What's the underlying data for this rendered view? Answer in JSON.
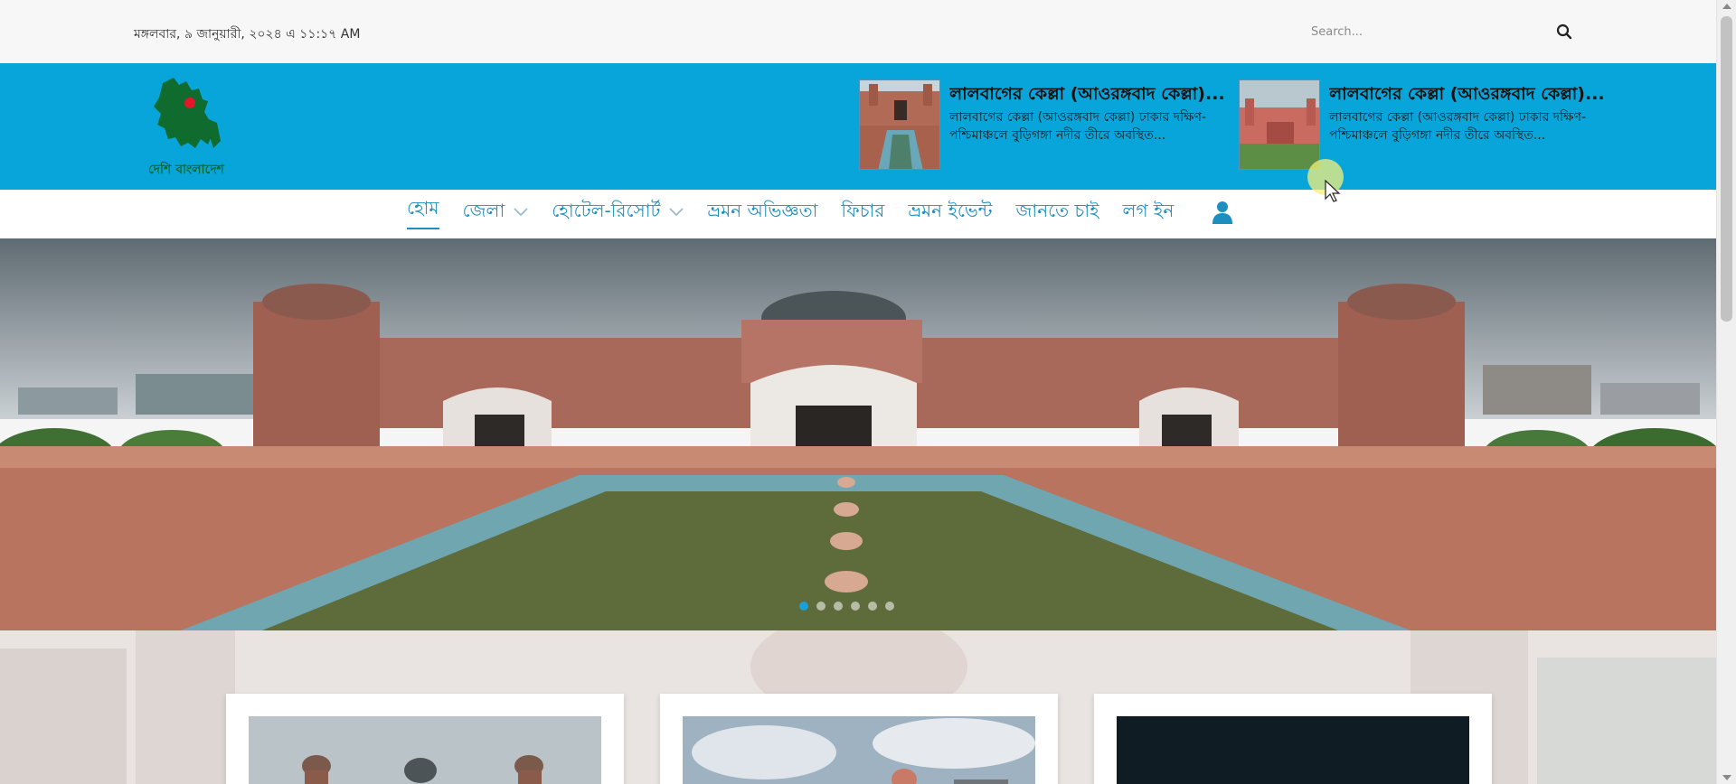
{
  "topbar": {
    "date": "মঙ্গলবার, ৯ জানুয়ারী, ২০২৪ এ ১১:১৭ AM",
    "search_placeholder": "Search...",
    "search_icon": "search-icon"
  },
  "header": {
    "logo_text": "দেশি বাংলাদেশ",
    "news": [
      {
        "title": "লালবাগের কেল্লা (আওরঙ্গবাদ কেল্লা)...",
        "excerpt": "লালবাগের কেল্লা (আওরঙ্গবাদ কেল্লা) ঢাকার দক্ষিণ-পশ্চিমাঞ্চলে বুড়িগঙ্গা নদীর তীরে অবস্থিত..."
      },
      {
        "title": "লালবাগের কেল্লা (আওরঙ্গবাদ কেল্লা)...",
        "excerpt": "লালবাগের কেল্লা (আওরঙ্গবাদ কেল্লা) ঢাকার দক্ষিণ-পশ্চিমাঞ্চলে বুড়িগঙ্গা নদীর তীরে অবস্থিত..."
      }
    ]
  },
  "nav": {
    "items": [
      {
        "label": "হোম"
      },
      {
        "label": "জেলা"
      },
      {
        "label": "হোটেল-রিসোর্ট"
      },
      {
        "label": "ভ্রমন অভিজ্ঞতা"
      },
      {
        "label": "ফিচার"
      },
      {
        "label": "ভ্রমন ইভেন্ট"
      },
      {
        "label": "জানতে চাই"
      },
      {
        "label": "লগ ইন"
      }
    ],
    "user_icon": "user-icon"
  },
  "slider": {
    "slide_count": 6,
    "active_index": 0
  },
  "colors": {
    "header_bg": "#07a5d9",
    "nav_text": "#1c8ec0",
    "topbar_bg": "#f7f7f7"
  }
}
